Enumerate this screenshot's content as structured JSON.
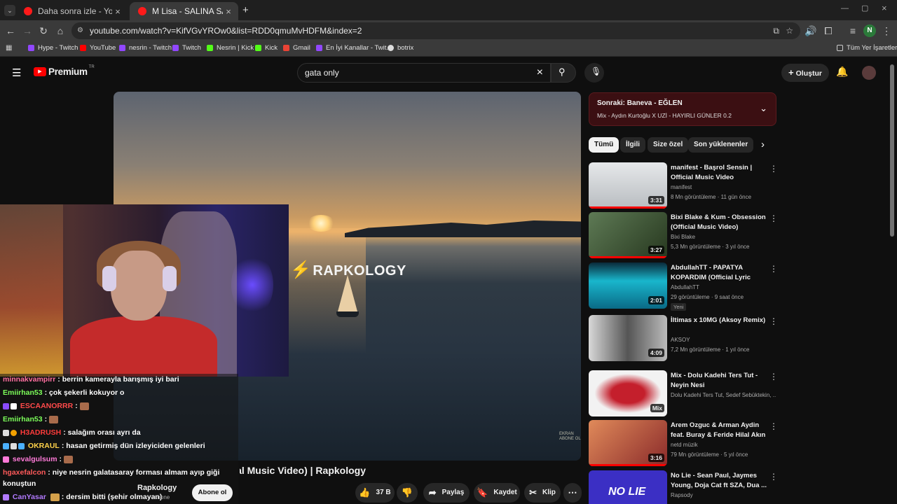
{
  "browser": {
    "tabs": [
      {
        "title": "Daha sonra izle - YouTube",
        "active": false
      },
      {
        "title": "M Lisa - SALINA SALINA (Offici",
        "active": true
      }
    ],
    "url": "youtube.com/watch?v=KifVGvYROw0&list=RDD0qmuMvHDFM&index=2",
    "profile_initial": "N",
    "bookmarks": [
      "Hype - Twitch",
      "YouTube",
      "nesrin - Twitch",
      "Twitch",
      "Nesrin | Kick",
      "Kick",
      "Gmail",
      "En İyi Kanallar - Twit...",
      "botrix"
    ],
    "all_bookmarks": "Tüm Yer İşaretleri"
  },
  "youtube": {
    "logo": "Premium",
    "logo_region": "TR",
    "search_value": "gata only",
    "create_label": "Oluştur"
  },
  "player": {
    "brand": "RAPKOLOGY",
    "watermark": "EKRAN ABONE OL"
  },
  "chat": [
    {
      "user": "minnakvampirr",
      "color": "#ff6fa0",
      "text": ": berrin kamerayla barışmış iyi bari"
    },
    {
      "user": "Emiirhan53",
      "color": "#7cff5a",
      "text": ": çok şekerli kokuyor o"
    },
    {
      "user": "ESCAANORRR",
      "color": "#ff4a4a",
      "text": ":"
    },
    {
      "user": "Emiirhan53",
      "color": "#7cff5a",
      "text": ":"
    },
    {
      "user": "H3ADRUSH",
      "color": "#ff3b3b",
      "text": ": salağım orası ayrı da"
    },
    {
      "user": "OKRAUL",
      "color": "#ffd24a",
      "text": ": hasan getirmiş dün izleyiciden gelenleri"
    },
    {
      "user": "sevalgulsum",
      "color": "#ff7ad8",
      "text": ":"
    },
    {
      "user": "hgaxefalcon",
      "color": "#ff5a5a",
      "text": ": niye nesrin galatasaray forması almam ayıp giği"
    },
    {
      "user": "",
      "color": "#ffffff",
      "text": "konuştun"
    },
    {
      "user": "CanYasar",
      "color": "#b27aff",
      "text": ": dersim bitti (şehir olmayan)"
    }
  ],
  "video": {
    "title": "M Lisa - SALINA SALINA (Official Music Video) | Rapkology",
    "channel": "Rapkology",
    "subs": "abone",
    "subscribe": "Abone ol",
    "likes": "37 B",
    "share": "Paylaş",
    "save": "Kaydet",
    "clip": "Klip"
  },
  "up_next": {
    "title": "Sonraki: Baneva - EĞLEN",
    "subtitle": "Mix - Aydın Kurtoğlu X UZİ - HAYIRLI GÜNLER 0.2"
  },
  "chips": [
    "Tümü",
    "İlgili",
    "Size özel",
    "Son yüklenenler"
  ],
  "recommendations": [
    {
      "title": "manifest - Başrol Sensin | Official Music Video",
      "channel": "manifest",
      "stats": "8 Mn görüntüleme · 11 gün önce",
      "duration": "3:31",
      "badge": "",
      "thumb": "#cfd2d6"
    },
    {
      "title": "Bixi Blake & Kum - Obsession (Official Music Video)",
      "channel": "Bixi Blake",
      "stats": "5,3 Mn görüntüleme · 3 yıl önce",
      "duration": "3:27",
      "badge": "",
      "thumb": "#3d5a3a"
    },
    {
      "title": "AbdullahTT - PAPATYA KOPARDIM (Official Lyric Vide...",
      "channel": "AbdullahTT",
      "stats": "29 görüntüleme · 9 saat önce",
      "duration": "2:01",
      "badge": "Yeni",
      "thumb": "#19b6cc"
    },
    {
      "title": "İltimas x 10MG (Aksoy Remix)",
      "channel": "AKSOY",
      "stats": "7,2 Mn görüntüleme · 1 yıl önce",
      "duration": "4:09",
      "badge": "",
      "thumb": "#9a9a9a"
    },
    {
      "title": "Mix - Dolu Kadehi Ters Tut - Neyin Nesi",
      "channel": "Dolu Kadehi Ters Tut, Sedef Sebüktekin, ...",
      "stats": "",
      "duration": "Mix",
      "badge": "",
      "thumb": "#c41f2c"
    },
    {
      "title": "Arem Ozguc & Arman Aydin feat. Buray & Feride Hilal Akın ...",
      "channel": "netd müzik",
      "stats": "79 Mn görüntüleme · 5 yıl önce",
      "duration": "3:16",
      "badge": "",
      "thumb": "#c46a3a"
    },
    {
      "title": "No Lie - Sean Paul, Jaymes Young, Doja Cat ft SZA, Dua ...",
      "channel": "Rapsody",
      "stats": "",
      "duration": "",
      "badge": "",
      "thumb": "#3b2fc4"
    }
  ]
}
